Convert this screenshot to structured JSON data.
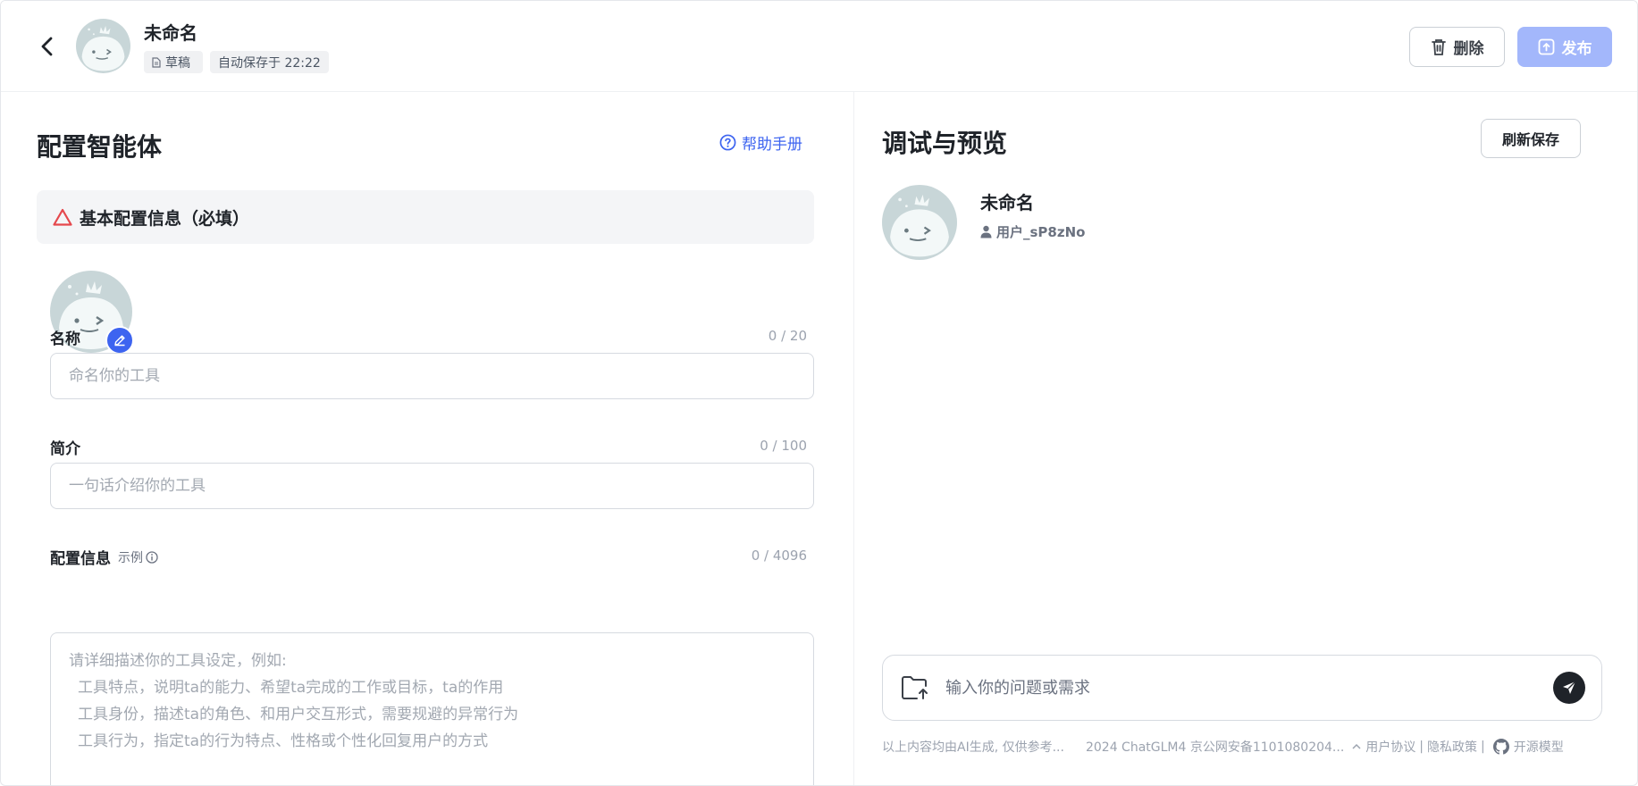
{
  "header": {
    "title": "未命名",
    "draft_badge": "草稿",
    "autosave_badge": "自动保存于 22:22",
    "delete_label": "删除",
    "publish_label": "发布"
  },
  "left": {
    "title": "配置智能体",
    "help_label": "帮助手册",
    "section_title": "基本配置信息（必填）",
    "name": {
      "label": "名称",
      "counter": "0 / 20",
      "placeholder": "命名你的工具"
    },
    "intro": {
      "label": "简介",
      "counter": "0 / 100",
      "placeholder": "一句话介绍你的工具"
    },
    "config": {
      "label": "配置信息",
      "example_label": "示例",
      "counter": "0 / 4096",
      "placeholder_lines": [
        "请详细描述你的工具设定，例如:",
        "工具特点，说明ta的能力、希望ta完成的工作或目标，ta的作用",
        "工具身份，描述ta的角色、和用户交互形式，需要规避的异常行为",
        "工具行为，指定ta的行为特点、性格或个性化回复用户的方式"
      ]
    }
  },
  "right": {
    "title": "调试与预览",
    "refresh_label": "刷新保存",
    "preview_name": "未命名",
    "preview_user": "用户_sP8zNo",
    "chat_placeholder": "输入你的问题或需求",
    "footer": {
      "disclaimer": "以上内容均由AI生成, 仅供参考...",
      "icp": "2024 ChatGLM4 京公网安备1101080204...",
      "user_agreement": "用户协议",
      "separator1": "|",
      "privacy": "隐私政策",
      "separator2": "|",
      "open_source": "开源模型"
    }
  },
  "colors": {
    "accent": "#3d64f0",
    "publish_disabled": "#a3b7fb",
    "warning": "#e5484d"
  }
}
